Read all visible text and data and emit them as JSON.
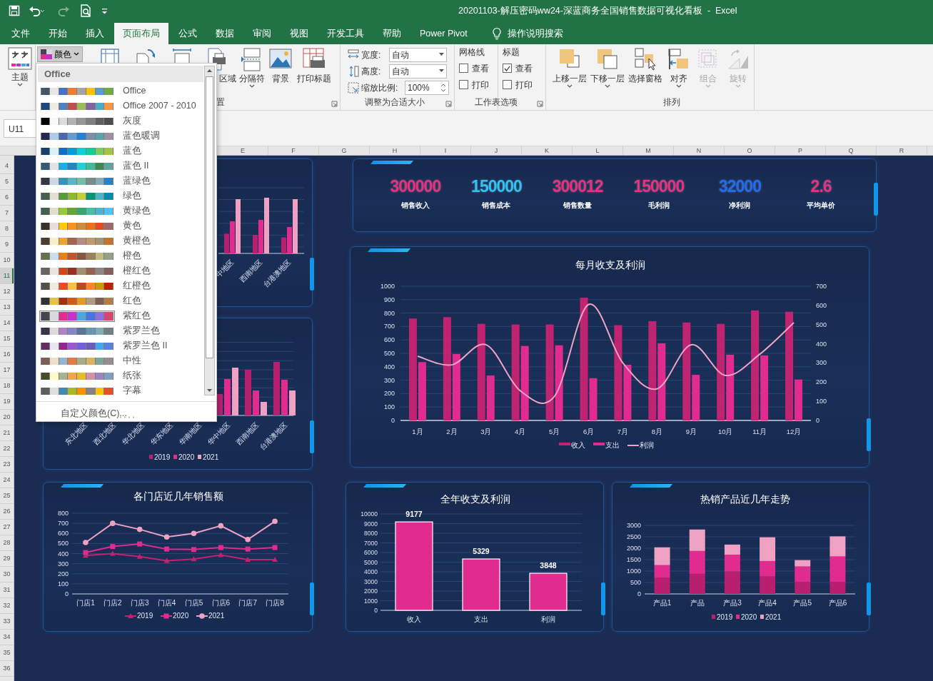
{
  "window": {
    "title": "20201103-解压密码ww24-深蓝商务全国销售数据可视化看板  -  Excel"
  },
  "quick_access": {
    "redo_disabled": true
  },
  "tabs": [
    {
      "label": "文件",
      "selected": false
    },
    {
      "label": "开始",
      "selected": false
    },
    {
      "label": "插入",
      "selected": false
    },
    {
      "label": "页面布局",
      "selected": true
    },
    {
      "label": "公式",
      "selected": false
    },
    {
      "label": "数据",
      "selected": false
    },
    {
      "label": "审阅",
      "selected": false
    },
    {
      "label": "视图",
      "selected": false
    },
    {
      "label": "开发工具",
      "selected": false
    },
    {
      "label": "帮助",
      "selected": false
    },
    {
      "label": "Power Pivot",
      "selected": false
    }
  ],
  "tell_me": {
    "label": "操作说明搜索"
  },
  "ribbon": {
    "theme_button": {
      "label": "主题",
      "menu": true
    },
    "colors_button": {
      "label": "颜色",
      "expanded": true
    },
    "page_setup": {
      "buttons": [
        {
          "label": "区域",
          "menu": false
        },
        {
          "label": "分隔符",
          "menu": true
        },
        {
          "label": "背景",
          "menu": false
        },
        {
          "label": "打印标题",
          "menu": false
        }
      ],
      "group_label": "置"
    },
    "scale": {
      "rows": [
        {
          "label": "宽度:",
          "value": "自动",
          "kind": "select"
        },
        {
          "label": "高度:",
          "value": "自动",
          "kind": "select"
        },
        {
          "label": "缩放比例:",
          "value": "100%",
          "kind": "spin"
        }
      ],
      "group_label": "调整为合适大小"
    },
    "sheet_options": {
      "columns": [
        {
          "heading": "网格线",
          "options": [
            {
              "label": "查看",
              "checked": false
            },
            {
              "label": "打印",
              "checked": false
            }
          ]
        },
        {
          "heading": "标题",
          "options": [
            {
              "label": "查看",
              "checked": true
            },
            {
              "label": "打印",
              "checked": false
            }
          ]
        }
      ],
      "group_label": "工作表选项"
    },
    "arrange": {
      "buttons": [
        {
          "label": "上移一层",
          "menu": true,
          "disabled": false
        },
        {
          "label": "下移一层",
          "menu": true,
          "disabled": false
        },
        {
          "label": "选择窗格",
          "menu": false,
          "disabled": false
        },
        {
          "label": "对齐",
          "menu": true,
          "disabled": false
        },
        {
          "label": "组合",
          "menu": true,
          "disabled": true
        },
        {
          "label": "旋转",
          "menu": true,
          "disabled": true
        }
      ],
      "group_label": "排列"
    }
  },
  "name_box": {
    "value": "U11"
  },
  "column_headers": [
    "E",
    "F",
    "G",
    "H",
    "I",
    "J",
    "K",
    "L",
    "M",
    "N",
    "O",
    "P",
    "Q",
    "R"
  ],
  "row_headers": [
    {
      "label": "4",
      "selected": false
    },
    {
      "label": "5",
      "selected": false
    },
    {
      "label": "6",
      "selected": false
    },
    {
      "label": "7",
      "selected": false
    },
    {
      "label": "8",
      "selected": false
    },
    {
      "label": "9",
      "selected": false
    },
    {
      "label": "10",
      "selected": false
    },
    {
      "label": "11",
      "selected": true
    },
    {
      "label": "12",
      "selected": false
    },
    {
      "label": "13",
      "selected": false
    },
    {
      "label": "14",
      "selected": false
    },
    {
      "label": "15",
      "selected": false
    },
    {
      "label": "16",
      "selected": false
    },
    {
      "label": "17",
      "selected": false
    },
    {
      "label": "18",
      "selected": false
    },
    {
      "label": "19",
      "selected": false
    },
    {
      "label": "20",
      "selected": false
    },
    {
      "label": "21",
      "selected": false
    },
    {
      "label": "22",
      "selected": false
    },
    {
      "label": "23",
      "selected": false
    },
    {
      "label": "24",
      "selected": false
    },
    {
      "label": "25",
      "selected": false
    },
    {
      "label": "26",
      "selected": false
    },
    {
      "label": "27",
      "selected": false
    },
    {
      "label": "28",
      "selected": false
    },
    {
      "label": "29",
      "selected": false
    },
    {
      "label": "30",
      "selected": false
    },
    {
      "label": "31",
      "selected": false
    },
    {
      "label": "32",
      "selected": false
    },
    {
      "label": "33",
      "selected": false
    },
    {
      "label": "34",
      "selected": false
    },
    {
      "label": "35",
      "selected": false
    },
    {
      "label": "36",
      "selected": false
    }
  ],
  "dashboard": {
    "region_chart_top": {
      "category_labels": [
        "中地区",
        "西南地区",
        "台港澳地区"
      ]
    },
    "region_chart_bottom": {
      "category_labels": [
        "东北地区",
        "西北地区",
        "华北地区",
        "华东地区",
        "华南地区",
        "华中地区",
        "西南地区",
        "台港澳地区"
      ],
      "legend": [
        {
          "name": "2019",
          "color": "#b8206f"
        },
        {
          "name": "2020",
          "color": "#e22b8e"
        },
        {
          "name": "2021",
          "color": "#eea1c2"
        }
      ]
    },
    "kpis": [
      {
        "value": "300000",
        "label": "销售收入",
        "color": "#e8307f"
      },
      {
        "value": "150000",
        "label": "销售成本",
        "color": "#2ec3f2"
      },
      {
        "value": "300012",
        "label": "销售数量",
        "color": "#e8307f"
      },
      {
        "value": "150000",
        "label": "毛利润",
        "color": "#e8307f"
      },
      {
        "value": "32000",
        "label": "净利润",
        "color": "#1f6cf2"
      },
      {
        "value": "2.6",
        "label": "平均单价",
        "color": "#e8307f"
      }
    ],
    "monthly_chart": {
      "chart_data": {
        "type": "bar",
        "title": "每月收支及利润",
        "categories": [
          "1月",
          "2月",
          "3月",
          "4月",
          "5月",
          "6月",
          "7月",
          "8月",
          "9月",
          "10月",
          "11月",
          "12月"
        ],
        "series": [
          {
            "name": "收入",
            "color": "#c0236f",
            "values": [
              760,
              770,
              720,
              715,
              715,
              915,
              710,
              740,
              730,
              720,
              820,
              810
            ]
          },
          {
            "name": "支出",
            "color": "#e22b8e",
            "values": [
              435,
              495,
              335,
              555,
              560,
              315,
              415,
              575,
              340,
              490,
              485,
              305
            ]
          },
          {
            "name": "利润",
            "type": "line",
            "axis": "y2",
            "color": "#f0a3c4",
            "values": [
              335,
              290,
              395,
              155,
              125,
              605,
              300,
              165,
              395,
              235,
              345,
              510
            ]
          }
        ],
        "stacked": false,
        "grid": true,
        "legend": "bottom",
        "ylim": [
          0,
          1000
        ],
        "yticks": [
          0,
          100,
          200,
          300,
          400,
          500,
          600,
          700,
          800,
          900,
          1000
        ],
        "y2lim": [
          0,
          700
        ],
        "y2ticks": [
          0,
          100,
          200,
          300,
          400,
          500,
          600,
          700
        ]
      }
    },
    "store_chart": {
      "chart_data": {
        "type": "line",
        "title": "各门店近几年销售额",
        "categories": [
          "门店1",
          "门店2",
          "门店3",
          "门店4",
          "门店5",
          "门店6",
          "门店7",
          "门店8"
        ],
        "series": [
          {
            "name": "2019",
            "marker": "triangle",
            "color": "#c0236f",
            "values": [
              380,
              400,
              370,
              330,
              345,
              385,
              340,
              340
            ]
          },
          {
            "name": "2020",
            "marker": "square",
            "color": "#e22b8e",
            "values": [
              410,
              470,
              495,
              445,
              440,
              460,
              445,
              460
            ]
          },
          {
            "name": "2021",
            "marker": "circle",
            "color": "#eea1c2",
            "values": [
              510,
              700,
              640,
              565,
              600,
              675,
              540,
              720
            ]
          }
        ],
        "grid": true,
        "legend": "bottom",
        "ylim": [
          0,
          800
        ],
        "yticks": [
          0,
          100,
          200,
          300,
          400,
          500,
          600,
          700,
          800
        ]
      }
    },
    "annual_chart": {
      "chart_data": {
        "type": "bar",
        "title": "全年收支及利润",
        "categories": [
          "收入",
          "支出",
          "利润"
        ],
        "values": [
          9177,
          5329,
          3848
        ],
        "color": "#e22b8e",
        "data_labels": true,
        "grid": true,
        "ylim": [
          0,
          10000
        ],
        "yticks": [
          0,
          1000,
          2000,
          3000,
          4000,
          5000,
          6000,
          7000,
          8000,
          9000,
          10000
        ]
      }
    },
    "product_chart": {
      "chart_data": {
        "type": "bar",
        "stacked": true,
        "title": "热销产品近几年走势",
        "categories": [
          "产品1",
          "产品",
          "产品3",
          "产品4",
          "产品5",
          "产品6"
        ],
        "series": [
          {
            "name": "2019",
            "color": "#b8206f",
            "values": [
              700,
              880,
              980,
              760,
              520,
              520
            ]
          },
          {
            "name": "2020",
            "color": "#e22b8e",
            "values": [
              560,
              1000,
              740,
              680,
              680,
              1120
            ]
          },
          {
            "name": "2021",
            "color": "#eea1c2",
            "values": [
              780,
              940,
              440,
              1040,
              280,
              880
            ]
          }
        ],
        "grid": true,
        "legend": "bottom",
        "ylim": [
          0,
          3000
        ],
        "yticks": [
          0,
          500,
          1000,
          1500,
          2000,
          2500,
          3000
        ]
      }
    }
  },
  "colors_menu": {
    "heading": "Office",
    "footer": "自定义颜色(C)...",
    "palettes": [
      {
        "name": "Office",
        "selected": false,
        "swatches": [
          {
            "color": "#44546a"
          },
          {
            "color": "#e7e6e6"
          },
          {
            "color": "#4472c4"
          },
          {
            "color": "#ed7d31"
          },
          {
            "color": "#a5a5a5"
          },
          {
            "color": "#ffc000"
          },
          {
            "color": "#5b9bd5"
          },
          {
            "color": "#70ad47"
          }
        ]
      },
      {
        "name": "Office 2007 - 2010",
        "selected": false,
        "swatches": [
          {
            "color": "#1f497d"
          },
          {
            "color": "#eeece1"
          },
          {
            "color": "#4f81bd"
          },
          {
            "color": "#c0504d"
          },
          {
            "color": "#9bbb59"
          },
          {
            "color": "#8064a2"
          },
          {
            "color": "#4bacc6"
          },
          {
            "color": "#f79646"
          }
        ]
      },
      {
        "name": "灰度",
        "selected": false,
        "swatches": [
          {
            "color": "#000000"
          },
          {
            "color": "#f8f8f8"
          },
          {
            "color": "#dddddd"
          },
          {
            "color": "#b2b2b2"
          },
          {
            "color": "#969696"
          },
          {
            "color": "#808080"
          },
          {
            "color": "#5f5f5f"
          },
          {
            "color": "#4d4d4d"
          }
        ]
      },
      {
        "name": "蓝色暖调",
        "selected": false,
        "swatches": [
          {
            "color": "#242852"
          },
          {
            "color": "#acccea"
          },
          {
            "color": "#4a66ac"
          },
          {
            "color": "#629dd1"
          },
          {
            "color": "#297fd5"
          },
          {
            "color": "#7f8fa9"
          },
          {
            "color": "#5aa2ae"
          },
          {
            "color": "#9d90a0"
          }
        ]
      },
      {
        "name": "蓝色",
        "selected": false,
        "swatches": [
          {
            "color": "#17406d"
          },
          {
            "color": "#dbeff9"
          },
          {
            "color": "#0f6fc6"
          },
          {
            "color": "#009dd9"
          },
          {
            "color": "#0bd0d9"
          },
          {
            "color": "#10cf9b"
          },
          {
            "color": "#7cca62"
          },
          {
            "color": "#a5c249"
          }
        ]
      },
      {
        "name": "蓝色 II",
        "selected": false,
        "swatches": [
          {
            "color": "#335b74"
          },
          {
            "color": "#dfe3e5"
          },
          {
            "color": "#1cade4"
          },
          {
            "color": "#2683c6"
          },
          {
            "color": "#27ced7"
          },
          {
            "color": "#42ba97"
          },
          {
            "color": "#3e8853"
          },
          {
            "color": "#62a39f"
          }
        ]
      },
      {
        "name": "蓝绿色",
        "selected": false,
        "swatches": [
          {
            "color": "#373545"
          },
          {
            "color": "#ced8e2"
          },
          {
            "color": "#3494ba"
          },
          {
            "color": "#58b6c0"
          },
          {
            "color": "#75bda7"
          },
          {
            "color": "#7a8c8e"
          },
          {
            "color": "#84acb6"
          },
          {
            "color": "#2683c6"
          }
        ]
      },
      {
        "name": "绿色",
        "selected": false,
        "swatches": [
          {
            "color": "#455f51"
          },
          {
            "color": "#e3ded1"
          },
          {
            "color": "#549e39"
          },
          {
            "color": "#8ab833"
          },
          {
            "color": "#c0cf3a"
          },
          {
            "color": "#029676"
          },
          {
            "color": "#4ab5c4"
          },
          {
            "color": "#0989b1"
          }
        ]
      },
      {
        "name": "黄绿色",
        "selected": false,
        "swatches": [
          {
            "color": "#455f51"
          },
          {
            "color": "#e3dec9"
          },
          {
            "color": "#99cb38"
          },
          {
            "color": "#63a537"
          },
          {
            "color": "#37a76f"
          },
          {
            "color": "#44c1a3"
          },
          {
            "color": "#4eb3cf"
          },
          {
            "color": "#51c3f9"
          }
        ]
      },
      {
        "name": "黄色",
        "selected": false,
        "swatches": [
          {
            "color": "#39302a"
          },
          {
            "color": "#e5dedb"
          },
          {
            "color": "#ffca08"
          },
          {
            "color": "#f8931d"
          },
          {
            "color": "#ce8d3e"
          },
          {
            "color": "#ec7016"
          },
          {
            "color": "#e64823"
          },
          {
            "color": "#9c6a6a"
          }
        ]
      },
      {
        "name": "黄橙色",
        "selected": false,
        "swatches": [
          {
            "color": "#4e3b30"
          },
          {
            "color": "#fbeec9"
          },
          {
            "color": "#f0a22e"
          },
          {
            "color": "#a5644e"
          },
          {
            "color": "#b58b80"
          },
          {
            "color": "#c3986d"
          },
          {
            "color": "#a19574"
          },
          {
            "color": "#c17529"
          }
        ]
      },
      {
        "name": "橙色",
        "selected": false,
        "swatches": [
          {
            "color": "#637052"
          },
          {
            "color": "#ccddea"
          },
          {
            "color": "#e48312"
          },
          {
            "color": "#bd582c"
          },
          {
            "color": "#865640"
          },
          {
            "color": "#9b8357"
          },
          {
            "color": "#c2bc80"
          },
          {
            "color": "#94a088"
          }
        ]
      },
      {
        "name": "橙红色",
        "selected": false,
        "swatches": [
          {
            "color": "#696464"
          },
          {
            "color": "#e9e5dc"
          },
          {
            "color": "#d34817"
          },
          {
            "color": "#9b2d1f"
          },
          {
            "color": "#a28e6a"
          },
          {
            "color": "#956251"
          },
          {
            "color": "#918485"
          },
          {
            "color": "#855d5d"
          }
        ]
      },
      {
        "name": "红橙色",
        "selected": false,
        "swatches": [
          {
            "color": "#505046"
          },
          {
            "color": "#eeece1"
          },
          {
            "color": "#e84c22"
          },
          {
            "color": "#ffbd47"
          },
          {
            "color": "#b64926"
          },
          {
            "color": "#ff8427"
          },
          {
            "color": "#cc9900"
          },
          {
            "color": "#b22600"
          }
        ]
      },
      {
        "name": "红色",
        "selected": false,
        "swatches": [
          {
            "color": "#323232"
          },
          {
            "color": "#e5c243"
          },
          {
            "color": "#a5300f"
          },
          {
            "color": "#d55816"
          },
          {
            "color": "#e19825"
          },
          {
            "color": "#b19c7d"
          },
          {
            "color": "#7f5f52"
          },
          {
            "color": "#b27d49"
          }
        ]
      },
      {
        "name": "紫红色",
        "selected": true,
        "swatches": [
          {
            "color": "#454551"
          },
          {
            "color": "#d8d9dc"
          },
          {
            "color": "#e32d91"
          },
          {
            "color": "#c830cc"
          },
          {
            "color": "#4ea6dc"
          },
          {
            "color": "#4775e7"
          },
          {
            "color": "#8971e1"
          },
          {
            "color": "#d54773"
          }
        ]
      },
      {
        "name": "紫罗兰色",
        "selected": false,
        "swatches": [
          {
            "color": "#373545"
          },
          {
            "color": "#dcd8dc"
          },
          {
            "color": "#ad84c6"
          },
          {
            "color": "#8784c7"
          },
          {
            "color": "#5d739a"
          },
          {
            "color": "#6997af"
          },
          {
            "color": "#84acb6"
          },
          {
            "color": "#6f8183"
          }
        ]
      },
      {
        "name": "紫罗兰色 II",
        "selected": false,
        "swatches": [
          {
            "color": "#632e62"
          },
          {
            "color": "#eae5eb"
          },
          {
            "color": "#92278f"
          },
          {
            "color": "#9b57d3"
          },
          {
            "color": "#755dd9"
          },
          {
            "color": "#665eb8"
          },
          {
            "color": "#45a5ed"
          },
          {
            "color": "#5982db"
          }
        ]
      },
      {
        "name": "中性",
        "selected": false,
        "swatches": [
          {
            "color": "#7d5e54"
          },
          {
            "color": "#eedec8"
          },
          {
            "color": "#93b6d2"
          },
          {
            "color": "#e07b4a"
          },
          {
            "color": "#a7ae86"
          },
          {
            "color": "#dbb35f"
          },
          {
            "color": "#7ba79d"
          },
          {
            "color": "#968c8c"
          }
        ]
      },
      {
        "name": "纸张",
        "selected": false,
        "swatches": [
          {
            "color": "#444d26"
          },
          {
            "color": "#fefac9"
          },
          {
            "color": "#a5b592"
          },
          {
            "color": "#f3a447"
          },
          {
            "color": "#e7bc29"
          },
          {
            "color": "#d092a7"
          },
          {
            "color": "#9c85c0"
          },
          {
            "color": "#809ec2"
          }
        ]
      },
      {
        "name": "字幕",
        "selected": false,
        "swatches": [
          {
            "color": "#5e5e5e"
          },
          {
            "color": "#dddddd"
          },
          {
            "color": "#418ab3"
          },
          {
            "color": "#a6b727"
          },
          {
            "color": "#f69200"
          },
          {
            "color": "#838383"
          },
          {
            "color": "#fec306"
          },
          {
            "color": "#df5327"
          }
        ]
      }
    ]
  }
}
